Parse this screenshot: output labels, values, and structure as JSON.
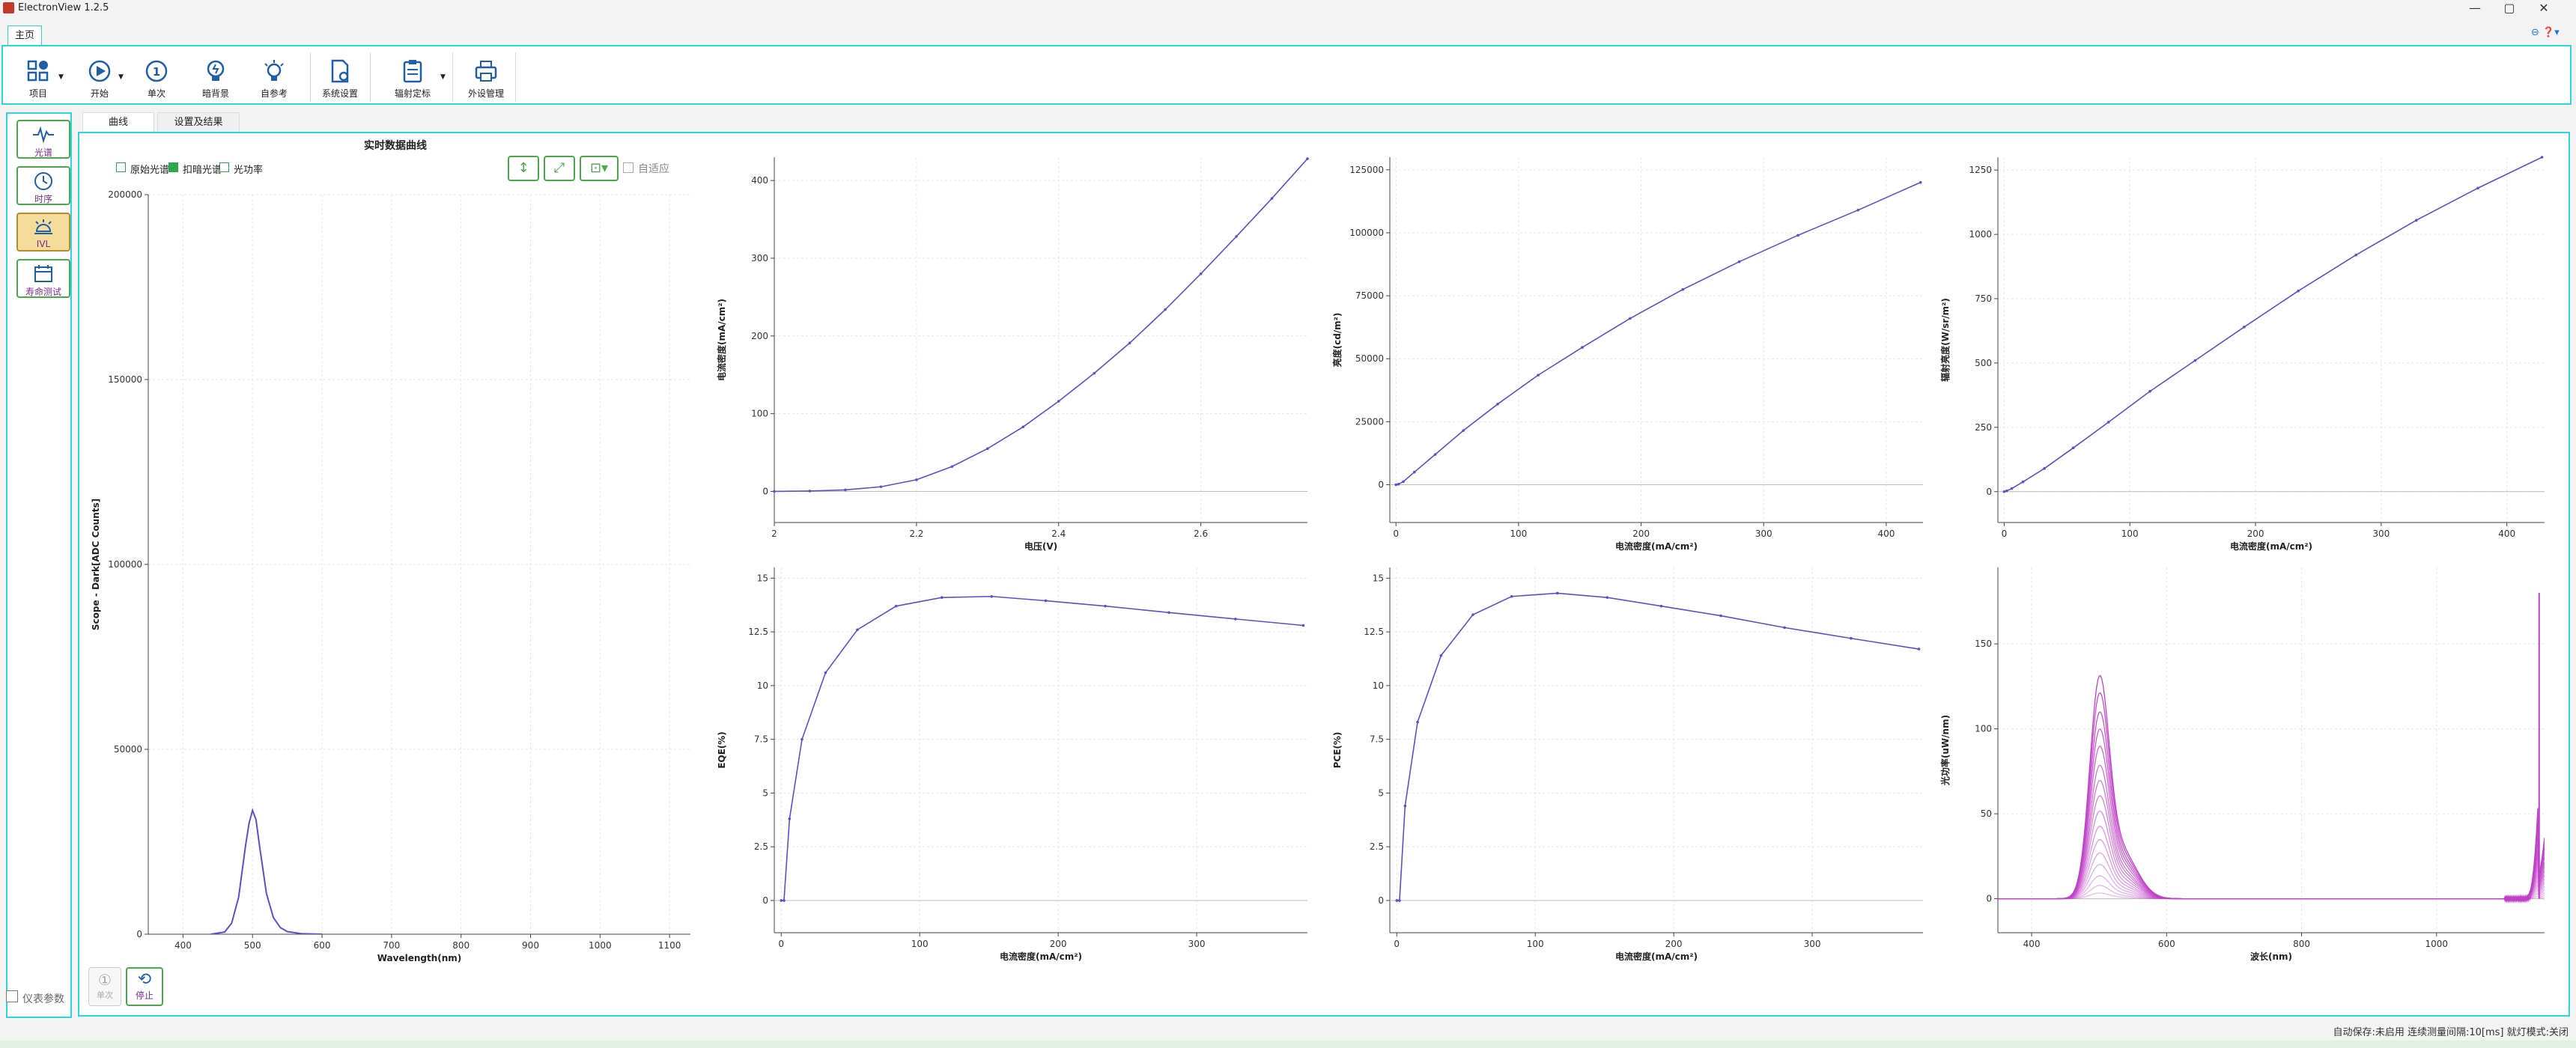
{
  "window": {
    "title": "ElectronView 1.2.5"
  },
  "ribbon_tab": "主页",
  "ribbon": {
    "buttons": [
      {
        "label": "项目",
        "icon": "grid-icon",
        "dropdown": true
      },
      {
        "label": "开始",
        "icon": "play-icon",
        "dropdown": true
      },
      {
        "label": "单次",
        "icon": "single-shot-icon",
        "dropdown": false
      },
      {
        "label": "暗背景",
        "icon": "lightbulb-dark-icon",
        "dropdown": false
      },
      {
        "label": "自参考",
        "icon": "lightbulb-ray-icon",
        "dropdown": false
      },
      {
        "label": "系统设置",
        "icon": "doc-gear-icon",
        "dropdown": false
      },
      {
        "label": "辐射定标",
        "icon": "clipboard-icon",
        "dropdown": true
      },
      {
        "label": "外设管理",
        "icon": "printer-icon",
        "dropdown": false
      }
    ]
  },
  "leftnav": {
    "items": [
      {
        "label": "光谱",
        "icon": "pulse-icon",
        "active": false
      },
      {
        "label": "时序",
        "icon": "clock-icon",
        "active": false
      },
      {
        "label": "IVL",
        "icon": "lamp-icon",
        "active": true
      },
      {
        "label": "寿命测试",
        "icon": "calendar-icon",
        "active": false
      }
    ],
    "instrument_params": "仪表参数"
  },
  "content_tabs": [
    "曲线",
    "设置及结果"
  ],
  "spectrum_chart": {
    "title": "实时数据曲线",
    "legend": [
      {
        "label": "原始光谱",
        "checked": false
      },
      {
        "label": "扣暗光谱",
        "checked": true
      },
      {
        "label": "光功率",
        "checked": false
      }
    ],
    "autofit_label": "自适应"
  },
  "buttons": {
    "single": "单次",
    "stop": "停止"
  },
  "status": {
    "text": "自动保存:未启用   连续测量间隔:10[ms]   就灯模式:关闭"
  },
  "chart_data": [
    {
      "type": "line",
      "id": "spectrum",
      "title": "实时数据曲线",
      "xlabel": "Wavelength(nm)",
      "ylabel": "Scope - Dark[ADC Counts]",
      "xlim": [
        350,
        1130
      ],
      "ylim": [
        0,
        200000
      ],
      "xticks": [
        400,
        500,
        600,
        700,
        800,
        900,
        1000,
        1100
      ],
      "yticks": [
        0,
        50000,
        100000,
        150000,
        200000
      ],
      "x": [
        440,
        460,
        470,
        480,
        490,
        495,
        500,
        505,
        510,
        520,
        530,
        540,
        550,
        570,
        600
      ],
      "y": [
        0,
        600,
        3000,
        10000,
        24000,
        30000,
        33500,
        31000,
        24000,
        11000,
        4500,
        1800,
        700,
        150,
        0
      ],
      "color": "#5a4fcf",
      "grid": true
    },
    {
      "type": "line",
      "id": "jv",
      "xlabel": "电压(V)",
      "ylabel": "电流密度(mA/cm²)",
      "xlim": [
        2.0,
        2.75
      ],
      "ylim": [
        -40,
        430
      ],
      "xticks": [
        2,
        2.2,
        2.4,
        2.6
      ],
      "yticks": [
        0,
        100,
        200,
        300,
        400
      ],
      "x": [
        2.0,
        2.05,
        2.1,
        2.15,
        2.2,
        2.25,
        2.3,
        2.35,
        2.4,
        2.45,
        2.5,
        2.55,
        2.6,
        2.65,
        2.7,
        2.75
      ],
      "y": [
        0,
        0.5,
        2,
        6,
        15,
        32,
        55,
        83,
        116,
        152,
        191,
        234,
        280,
        328,
        377,
        428
      ],
      "color": "#5a4fcf",
      "grid": true
    },
    {
      "type": "line",
      "id": "luminance",
      "xlabel": "电流密度(mA/cm²)",
      "ylabel": "亮度(cd/m²)",
      "xlim": [
        -5,
        430
      ],
      "ylim": [
        -15000,
        130000
      ],
      "xticks": [
        0,
        100,
        200,
        300,
        400
      ],
      "yticks": [
        0,
        25000,
        50000,
        75000,
        100000,
        125000
      ],
      "x": [
        0,
        2,
        6,
        15,
        32,
        55,
        83,
        116,
        152,
        191,
        234,
        280,
        328,
        377,
        428
      ],
      "y": [
        0,
        200,
        1200,
        5000,
        12000,
        21500,
        32000,
        43500,
        54500,
        66000,
        77500,
        88500,
        99000,
        109000,
        120000
      ],
      "color": "#5a4fcf",
      "grid": true
    },
    {
      "type": "line",
      "id": "radiance",
      "xlabel": "电流密度(mA/cm²)",
      "ylabel": "辐射亮度(W/sr/m²)",
      "xlim": [
        -5,
        430
      ],
      "ylim": [
        -120,
        1300
      ],
      "xticks": [
        0,
        100,
        200,
        300,
        400
      ],
      "yticks": [
        0,
        250,
        500,
        750,
        1000,
        1250
      ],
      "x": [
        0,
        2,
        6,
        15,
        32,
        55,
        83,
        116,
        152,
        191,
        234,
        280,
        328,
        377,
        428
      ],
      "y": [
        0,
        3,
        12,
        38,
        90,
        170,
        270,
        390,
        510,
        640,
        780,
        920,
        1055,
        1180,
        1300
      ],
      "color": "#5a4fcf",
      "grid": true
    },
    {
      "type": "line",
      "id": "eqe",
      "xlabel": "电流密度(mA/cm²)",
      "ylabel": "EQE(%)",
      "xlim": [
        -5,
        380
      ],
      "ylim": [
        -1.5,
        15.5
      ],
      "xticks": [
        0,
        100,
        200,
        300
      ],
      "yticks": [
        0,
        2.5,
        5,
        7.5,
        10,
        12.5,
        15
      ],
      "x": [
        0,
        2,
        6,
        15,
        32,
        55,
        83,
        116,
        152,
        191,
        234,
        280,
        328,
        377
      ],
      "y": [
        0,
        0,
        3.8,
        7.5,
        10.6,
        12.6,
        13.7,
        14.1,
        14.15,
        13.95,
        13.7,
        13.4,
        13.1,
        12.8
      ],
      "color": "#5a4fcf",
      "grid": true
    },
    {
      "type": "line",
      "id": "pce",
      "xlabel": "电流密度(mA/cm²)",
      "ylabel": "PCE(%)",
      "xlim": [
        -5,
        380
      ],
      "ylim": [
        -1.5,
        15.5
      ],
      "xticks": [
        0,
        100,
        200,
        300
      ],
      "yticks": [
        0,
        2.5,
        5,
        7.5,
        10,
        12.5,
        15
      ],
      "x": [
        0,
        2,
        6,
        15,
        32,
        55,
        83,
        116,
        152,
        191,
        234,
        280,
        328,
        377
      ],
      "y": [
        0,
        0,
        4.4,
        8.3,
        11.4,
        13.3,
        14.15,
        14.3,
        14.1,
        13.7,
        13.25,
        12.7,
        12.2,
        11.7
      ],
      "color": "#5a4fcf",
      "grid": true
    },
    {
      "type": "line",
      "id": "spectra-family",
      "xlabel": "波长(nm)",
      "ylabel": "光功率(uW/nm)",
      "xlim": [
        350,
        1160
      ],
      "ylim": [
        -20,
        195
      ],
      "xticks": [
        400,
        600,
        800,
        1000
      ],
      "yticks": [
        0,
        50,
        100,
        150
      ],
      "peak_wavelength": 500,
      "peaks": [
        117,
        108,
        98,
        89,
        80,
        70,
        62,
        54,
        46,
        38,
        31,
        24,
        18,
        12,
        7,
        3
      ],
      "edge_rise": 180,
      "color": "#c040c8",
      "grid": true
    }
  ]
}
